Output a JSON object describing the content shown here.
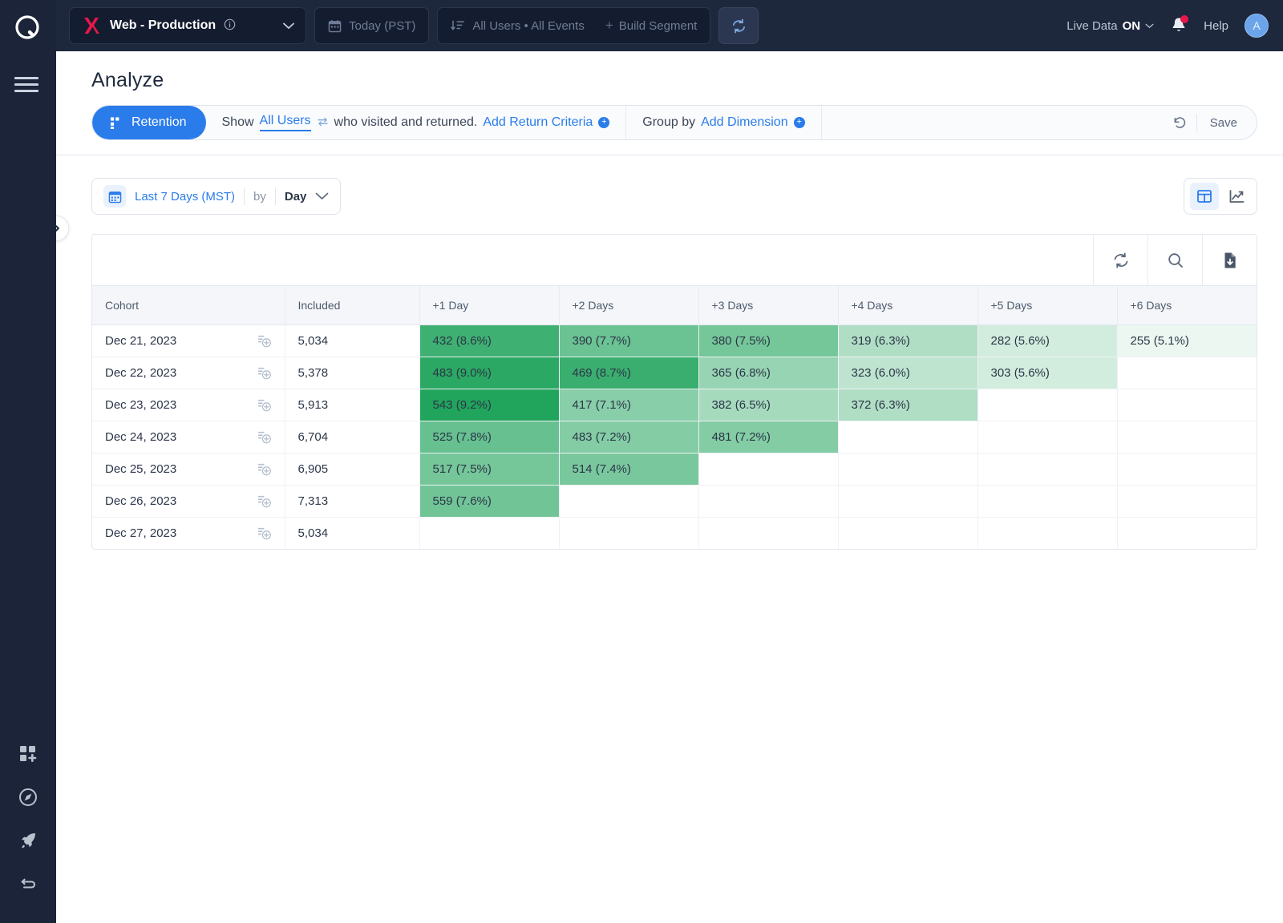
{
  "topbar": {
    "project": "Web - Production",
    "info_icon": "info-icon",
    "date_filter": "Today (PST)",
    "segment_filter": "All Users • All Events",
    "build_segment": "Build Segment",
    "refresh_icon": "refresh-icon",
    "live_data_label": "Live Data",
    "live_data_state": "ON",
    "help": "Help",
    "avatar_initial": "A"
  },
  "page": {
    "title": "Analyze"
  },
  "query": {
    "report_type": "Retention",
    "show_label": "Show",
    "audience": "All Users",
    "clause": "who visited and returned.",
    "add_return_criteria": "Add Return Criteria",
    "group_by_label": "Group by",
    "add_dimension": "Add Dimension",
    "undo_icon": "undo-icon",
    "save_label": "Save"
  },
  "controls": {
    "calendar_icon": "calendar-icon",
    "date_range": "Last 7 Days (MST)",
    "by_label": "by",
    "granularity": "Day",
    "chevron_icon": "chevron-down-icon",
    "view_table_icon": "table-view-icon",
    "view_chart_icon": "line-chart-view-icon",
    "active_view": "table"
  },
  "table_toolbar": {
    "refresh_icon": "refresh-icon",
    "search_icon": "search-icon",
    "download_icon": "download-file-icon"
  },
  "chart_data": {
    "type": "table",
    "title": "Retention cohort table",
    "columns": [
      "Cohort",
      "Included",
      "+1 Day",
      "+2 Days",
      "+3 Days",
      "+4 Days",
      "+5 Days",
      "+6 Days"
    ],
    "rows": [
      {
        "cohort": "Dec 21, 2023",
        "included": "5,034",
        "cells": [
          {
            "text": "432 (8.6%)",
            "pct": 8.6
          },
          {
            "text": "390 (7.7%)",
            "pct": 7.7
          },
          {
            "text": "380 (7.5%)",
            "pct": 7.5
          },
          {
            "text": "319 (6.3%)",
            "pct": 6.3
          },
          {
            "text": "282 (5.6%)",
            "pct": 5.6
          },
          {
            "text": "255 (5.1%)",
            "pct": 5.1
          }
        ]
      },
      {
        "cohort": "Dec 22, 2023",
        "included": "5,378",
        "cells": [
          {
            "text": "483 (9.0%)",
            "pct": 9.0
          },
          {
            "text": "469 (8.7%)",
            "pct": 8.7
          },
          {
            "text": "365 (6.8%)",
            "pct": 6.8
          },
          {
            "text": "323 (6.0%)",
            "pct": 6.0
          },
          {
            "text": "303 (5.6%)",
            "pct": 5.6
          },
          {
            "text": "",
            "pct": null
          }
        ]
      },
      {
        "cohort": "Dec 23, 2023",
        "included": "5,913",
        "cells": [
          {
            "text": "543 (9.2%)",
            "pct": 9.2
          },
          {
            "text": "417 (7.1%)",
            "pct": 7.1
          },
          {
            "text": "382 (6.5%)",
            "pct": 6.5
          },
          {
            "text": "372 (6.3%)",
            "pct": 6.3
          },
          {
            "text": "",
            "pct": null
          },
          {
            "text": "",
            "pct": null
          }
        ]
      },
      {
        "cohort": "Dec 24, 2023",
        "included": "6,704",
        "cells": [
          {
            "text": "525 (7.8%)",
            "pct": 7.8
          },
          {
            "text": "483 (7.2%)",
            "pct": 7.2
          },
          {
            "text": "481 (7.2%)",
            "pct": 7.2
          },
          {
            "text": "",
            "pct": null
          },
          {
            "text": "",
            "pct": null
          },
          {
            "text": "",
            "pct": null
          }
        ]
      },
      {
        "cohort": "Dec 25, 2023",
        "included": "6,905",
        "cells": [
          {
            "text": "517 (7.5%)",
            "pct": 7.5
          },
          {
            "text": "514 (7.4%)",
            "pct": 7.4
          },
          {
            "text": "",
            "pct": null
          },
          {
            "text": "",
            "pct": null
          },
          {
            "text": "",
            "pct": null
          },
          {
            "text": "",
            "pct": null
          }
        ]
      },
      {
        "cohort": "Dec 26, 2023",
        "included": "7,313",
        "cells": [
          {
            "text": "559 (7.6%)",
            "pct": 7.6
          },
          {
            "text": "",
            "pct": null
          },
          {
            "text": "",
            "pct": null
          },
          {
            "text": "",
            "pct": null
          },
          {
            "text": "",
            "pct": null
          },
          {
            "text": "",
            "pct": null
          }
        ]
      },
      {
        "cohort": "Dec 27, 2023",
        "included": "5,034",
        "cells": [
          {
            "text": "",
            "pct": null
          },
          {
            "text": "",
            "pct": null
          },
          {
            "text": "",
            "pct": null
          },
          {
            "text": "",
            "pct": null
          },
          {
            "text": "",
            "pct": null
          },
          {
            "text": "",
            "pct": null
          }
        ]
      }
    ],
    "heat_min_pct": 5.0,
    "heat_max_pct": 9.2,
    "heat_color": "#21a45c"
  },
  "sidebar": {
    "menu_icon": "hamburger-menu-icon",
    "items": [
      {
        "icon": "add-board-icon"
      },
      {
        "icon": "compass-icon"
      },
      {
        "icon": "rocket-icon"
      },
      {
        "icon": "loop-icon"
      }
    ]
  },
  "colors": {
    "accent": "#2a7ceb",
    "topbar_bg": "#1e283c",
    "heat": "#21a45c",
    "alert": "#e8174a"
  },
  "panel_toggle": {
    "icon": "chevron-right-icon"
  }
}
